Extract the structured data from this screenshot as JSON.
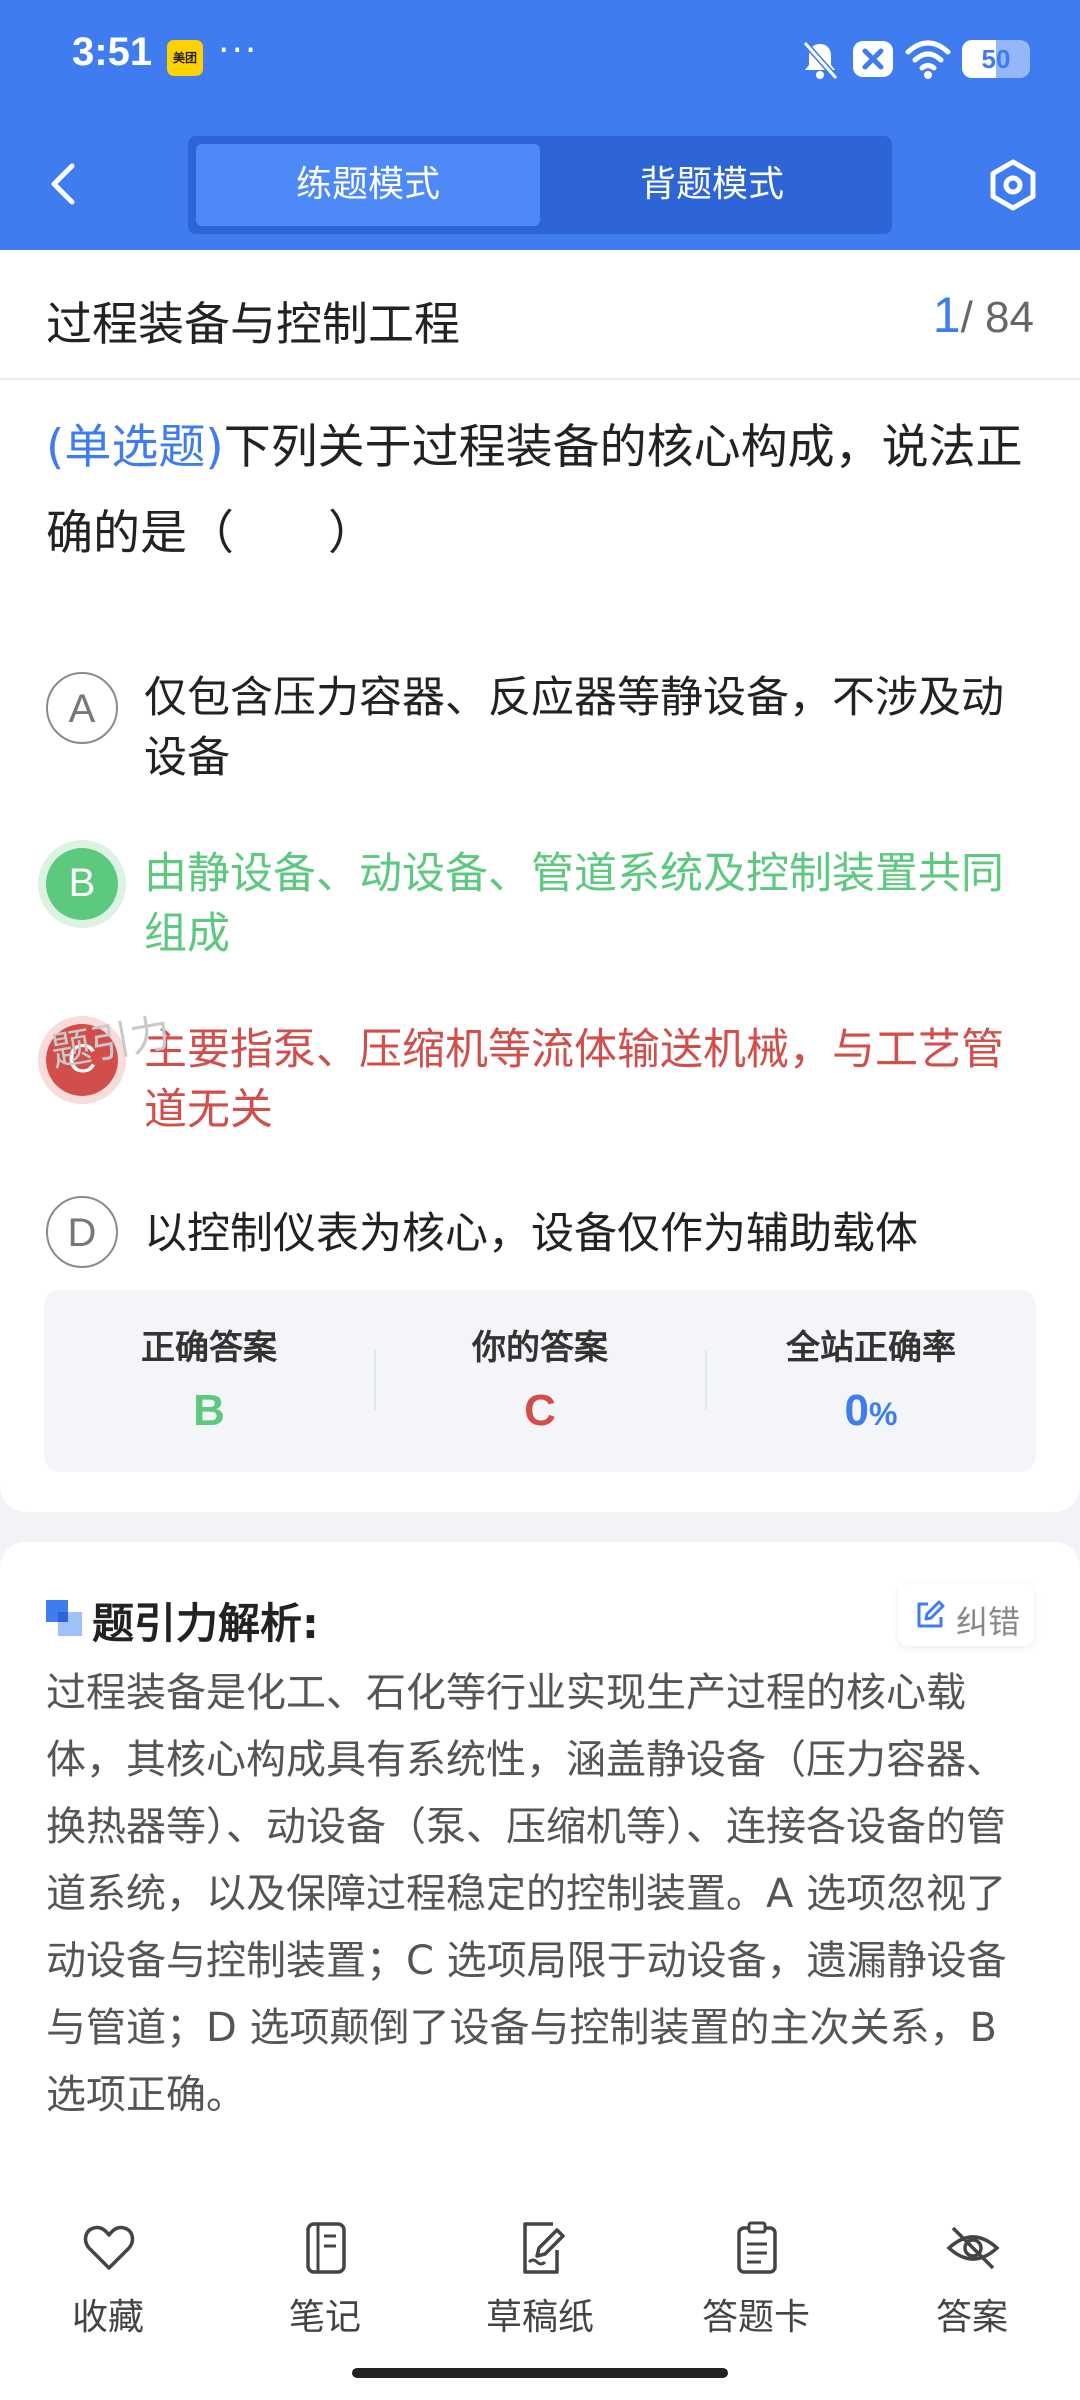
{
  "status_bar": {
    "time": "3:51",
    "app_badge": "美团",
    "more": "···",
    "battery_level": "50",
    "battery_percent": 50,
    "icons": [
      "bell-off-icon",
      "close-badge-icon",
      "wifi-icon",
      "battery-icon"
    ]
  },
  "nav": {
    "back_icon": "chevron-left-icon",
    "tabs": [
      {
        "label": "练题模式",
        "active": true
      },
      {
        "label": "背题模式",
        "active": false
      }
    ],
    "settings_icon": "hexagon-settings-icon"
  },
  "subject": {
    "title": "过程装备与控制工程",
    "current_index": "1",
    "total": "/ 84"
  },
  "question": {
    "type": "(单选题)",
    "text": "下列关于过程装备的核心构成，说法正确的是（　　）"
  },
  "options": [
    {
      "key": "A",
      "text": "仅包含压力容器、反应器等静设备，不涉及动设备",
      "state": "neutral"
    },
    {
      "key": "B",
      "text": "由静设备、动设备、管道系统及控制装置共同组成",
      "state": "correct"
    },
    {
      "key": "C",
      "text": "主要指泵、压缩机等流体输送机械，与工艺管道无关",
      "state": "wrong"
    },
    {
      "key": "D",
      "text": "以控制仪表为核心，设备仅作为辅助载体",
      "state": "neutral"
    }
  ],
  "watermark": "题引力",
  "answer_summary": {
    "correct_label": "正确答案",
    "correct_value": "B",
    "yours_label": "你的答案",
    "yours_value": "C",
    "rate_label": "全站正确率",
    "rate_value": "0",
    "rate_unit": "%"
  },
  "analysis": {
    "title": "题引力解析:",
    "report_label": "纠错",
    "text": "过程装备是化工、石化等行业实现生产过程的核心载体，其核心构成具有系统性，涵盖静设备（压力容器、换热器等）、动设备（泵、压缩机等）、连接各设备的管道系统，以及保障过程稳定的控制装置。A 选项忽视了动设备与控制装置；C 选项局限于动设备，遗漏静设备与管道；D 选项颠倒了设备与控制装置的主次关系，B 选项正确。"
  },
  "bottom_bar": [
    {
      "label": "收藏",
      "icon": "heart-icon"
    },
    {
      "label": "笔记",
      "icon": "notebook-icon"
    },
    {
      "label": "草稿纸",
      "icon": "draft-paper-icon"
    },
    {
      "label": "答题卡",
      "icon": "answer-sheet-icon"
    },
    {
      "label": "答案",
      "icon": "eye-off-icon"
    }
  ],
  "colors": {
    "primary": "#3f7cf0",
    "correct": "#5cc97f",
    "wrong": "#d24e4a"
  }
}
